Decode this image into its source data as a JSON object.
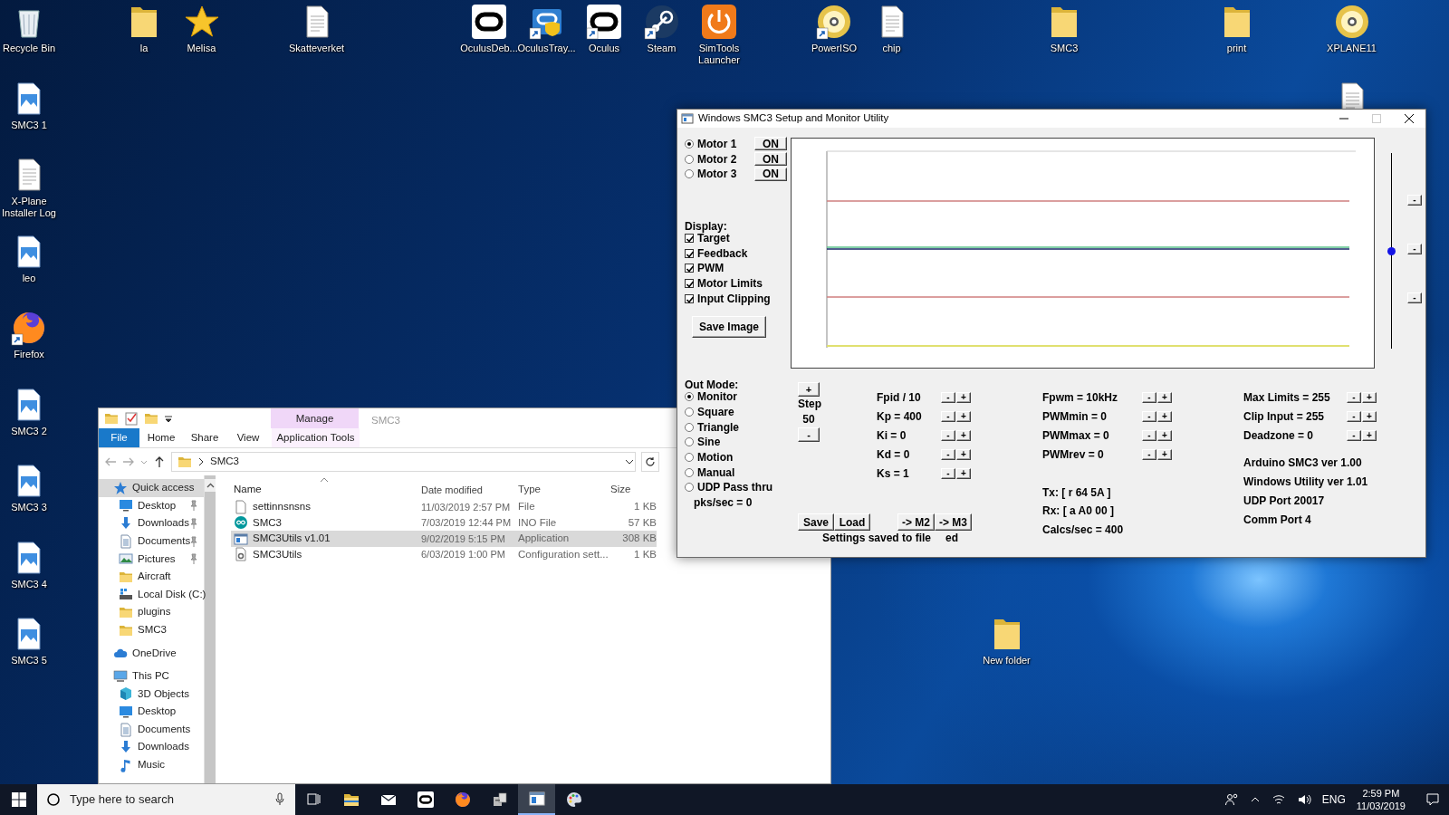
{
  "desktop": {
    "icons": [
      {
        "label": "Recycle Bin",
        "kind": "recycle",
        "shortcut": false
      },
      {
        "label": "la",
        "kind": "folder",
        "shortcut": false
      },
      {
        "label": "Melisa",
        "kind": "star",
        "shortcut": false
      },
      {
        "label": "Skatteverket",
        "kind": "document",
        "shortcut": false
      },
      {
        "label": "OculusDeb...",
        "kind": "ring",
        "shortcut": false
      },
      {
        "label": "OculusTray...",
        "kind": "shield",
        "shortcut": true
      },
      {
        "label": "Oculus",
        "kind": "ring",
        "shortcut": true
      },
      {
        "label": "Steam",
        "kind": "steam",
        "shortcut": true
      },
      {
        "label": "SimTools Launcher",
        "kind": "power",
        "shortcut": false
      },
      {
        "label": "PowerISO",
        "kind": "disc",
        "shortcut": true
      },
      {
        "label": "chip",
        "kind": "document",
        "shortcut": false
      },
      {
        "label": "SMC3",
        "kind": "folder",
        "shortcut": false
      },
      {
        "label": "print",
        "kind": "folder",
        "shortcut": false
      },
      {
        "label": "XPLANE11",
        "kind": "disc",
        "shortcut": false
      },
      {
        "label": "SMC3 1",
        "kind": "image",
        "shortcut": false
      },
      {
        "kind": "document",
        "shortcut": false
      },
      {
        "label": "X-Plane Installer Log",
        "kind": "document",
        "shortcut": false
      },
      {
        "label": "leo",
        "kind": "image",
        "shortcut": false
      },
      {
        "label": "Firefox",
        "kind": "firefox",
        "shortcut": true
      },
      {
        "label": "SMC3 2",
        "kind": "image",
        "shortcut": false
      },
      {
        "label": "SMC3 3",
        "kind": "image",
        "shortcut": false
      },
      {
        "label": "SMC3 4",
        "kind": "image",
        "shortcut": false
      },
      {
        "label": "SMC3 5",
        "kind": "image",
        "shortcut": false
      },
      {
        "label": "New folder",
        "kind": "folder",
        "shortcut": false
      }
    ]
  },
  "explorer": {
    "contextual_header": "Manage",
    "title": "SMC3",
    "ribbon_tabs": [
      {
        "label": "File",
        "kind": "file"
      },
      {
        "label": "Home",
        "kind": "plain"
      },
      {
        "label": "Share",
        "kind": "plain"
      },
      {
        "label": "View",
        "kind": "plain"
      },
      {
        "label": "Application Tools",
        "kind": "contextual"
      }
    ],
    "address": "SMC3",
    "nav": [
      {
        "label": "Quick access",
        "kind": "star",
        "selected": true,
        "pinned": false,
        "children": [
          {
            "label": "Desktop",
            "kind": "desktop",
            "selected": false,
            "pinned": true
          },
          {
            "label": "Downloads",
            "kind": "downloads",
            "selected": false,
            "pinned": true
          },
          {
            "label": "Documents",
            "kind": "documents",
            "selected": false,
            "pinned": true
          },
          {
            "label": "Pictures",
            "kind": "pictures",
            "selected": false,
            "pinned": true
          },
          {
            "label": "Aircraft",
            "kind": "folder",
            "selected": false,
            "pinned": false
          },
          {
            "label": "Local Disk (C:)",
            "kind": "disk",
            "selected": false,
            "pinned": false
          },
          {
            "label": "plugins",
            "kind": "folder",
            "selected": false,
            "pinned": false
          },
          {
            "label": "SMC3",
            "kind": "folder",
            "selected": false,
            "pinned": false
          }
        ]
      },
      {
        "label": "OneDrive",
        "kind": "cloud",
        "selected": false,
        "pinned": false
      },
      {
        "label": "This PC",
        "kind": "pc",
        "selected": false,
        "pinned": false,
        "children": [
          {
            "label": "3D Objects",
            "kind": "cube",
            "selected": false,
            "pinned": false
          },
          {
            "label": "Desktop",
            "kind": "desktop",
            "selected": false,
            "pinned": false
          },
          {
            "label": "Documents",
            "kind": "documents",
            "selected": false,
            "pinned": false
          },
          {
            "label": "Downloads",
            "kind": "downloads",
            "selected": false,
            "pinned": false
          },
          {
            "label": "Music",
            "kind": "music",
            "selected": false,
            "pinned": false
          }
        ]
      }
    ],
    "columns": [
      "Name",
      "Date modified",
      "Type",
      "Size"
    ],
    "files": [
      {
        "name": "settinnsnsns",
        "date": "11/03/2019 2:57 PM",
        "type": "File",
        "size": "1 KB",
        "kind": "file",
        "selected": false
      },
      {
        "name": "SMC3",
        "date": "7/03/2019 12:44 PM",
        "type": "INO File",
        "size": "57 KB",
        "kind": "ino",
        "selected": false
      },
      {
        "name": "SMC3Utils v1.01",
        "date": "9/02/2019 5:15 PM",
        "type": "Application",
        "size": "308 KB",
        "kind": "app",
        "selected": true
      },
      {
        "name": "SMC3Utils",
        "date": "6/03/2019 1:00 PM",
        "type": "Configuration sett...",
        "size": "1 KB",
        "kind": "config",
        "selected": false
      }
    ]
  },
  "smc3": {
    "title": "Windows SMC3 Setup and Monitor Utility",
    "maximize_disabled": true,
    "motors": [
      {
        "label": "Motor 1",
        "selected": true,
        "button": "ON"
      },
      {
        "label": "Motor 2",
        "selected": false,
        "button": "ON"
      },
      {
        "label": "Motor 3",
        "selected": false,
        "button": "ON"
      }
    ],
    "display_label": "Display:",
    "display_options": [
      {
        "label": "Target",
        "checked": true
      },
      {
        "label": "Feedback",
        "checked": true
      },
      {
        "label": "PWM",
        "checked": true
      },
      {
        "label": "Motor Limits",
        "checked": true
      },
      {
        "label": "Input Clipping",
        "checked": true
      }
    ],
    "save_image": "Save Image",
    "slider": {
      "level": 0.5
    },
    "side_buttons": [
      "-",
      "-",
      "-"
    ],
    "out_mode_label": "Out Mode:",
    "out_modes": [
      {
        "label": "Monitor",
        "selected": true
      },
      {
        "label": "Square",
        "selected": false
      },
      {
        "label": "Triangle",
        "selected": false
      },
      {
        "label": "Sine",
        "selected": false
      },
      {
        "label": "Motion",
        "selected": false
      },
      {
        "label": "Manual",
        "selected": false
      },
      {
        "label": "UDP Pass thru",
        "selected": false
      }
    ],
    "packets": "pks/sec = 0",
    "step": {
      "plus": "+",
      "label": "Step",
      "value": "50",
      "minus": "-"
    },
    "pid_params": [
      {
        "label": "Fpid / 10",
        "minus": "-",
        "plus": "+"
      },
      {
        "label": "Kp = 400",
        "minus": "-",
        "plus": "+"
      },
      {
        "label": "Ki = 0",
        "minus": "-",
        "plus": "+"
      },
      {
        "label": "Kd = 0",
        "minus": "-",
        "plus": "+"
      },
      {
        "label": "Ks = 1",
        "minus": "-",
        "plus": "+"
      }
    ],
    "pwm_params": [
      {
        "label": "Fpwm = 10kHz",
        "minus": "-",
        "plus": "+"
      },
      {
        "label": "PWMmin = 0",
        "minus": "-",
        "plus": "+"
      },
      {
        "label": "PWMmax = 0",
        "minus": "-",
        "plus": "+"
      },
      {
        "label": "PWMrev = 0",
        "minus": "-",
        "plus": "+"
      }
    ],
    "limit_params": [
      {
        "label": "Max Limits = 255",
        "minus": "-",
        "plus": "+"
      },
      {
        "label": "Clip Input = 255",
        "minus": "-",
        "plus": "+"
      },
      {
        "label": "Deadzone = 0",
        "minus": "-",
        "plus": "+"
      }
    ],
    "file_buttons": [
      "Save",
      "Load"
    ],
    "copy_buttons": [
      "-> M2",
      "-> M3"
    ],
    "status": "Settings saved to file",
    "status_fragment": "ed",
    "comms": [
      "Tx: [ r 64 5A ]",
      "Rx: [ a A0 00 ]",
      "Calcs/sec = 400"
    ],
    "info": [
      "Arduino SMC3 ver 1.00",
      "Windows Utility ver 1.01",
      "UDP Port 20017",
      "Comm Port 4"
    ]
  },
  "taskbar": {
    "search_placeholder": "Type here to search",
    "apps": [
      {
        "kind": "taskview",
        "active": false
      },
      {
        "kind": "explorer",
        "active": false
      },
      {
        "kind": "mail",
        "active": false
      },
      {
        "kind": "ring",
        "active": false
      },
      {
        "kind": "firefox",
        "active": false
      },
      {
        "kind": "server",
        "active": false
      },
      {
        "kind": "window",
        "active": true
      },
      {
        "kind": "palette",
        "active": false
      }
    ],
    "language": "ENG",
    "time": "2:59 PM",
    "date": "11/03/2019"
  }
}
